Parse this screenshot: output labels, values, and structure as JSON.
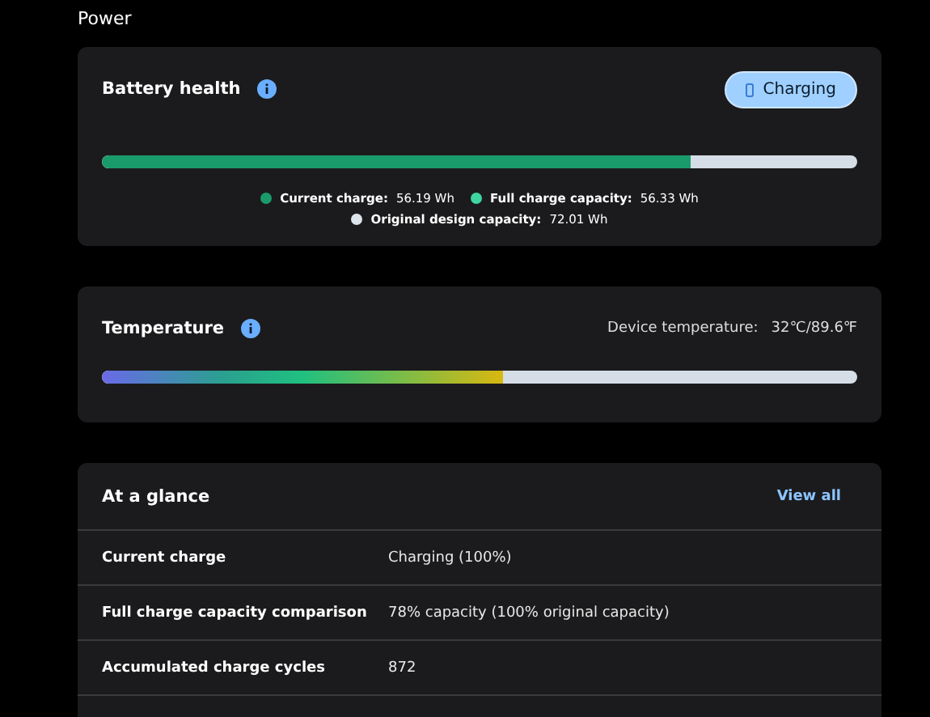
{
  "page_title": "Power",
  "battery": {
    "title": "Battery health",
    "status_button": "Charging",
    "level": 0.78,
    "legend": [
      {
        "label": "Current charge:",
        "value": "56.19 Wh",
        "color": "#1a9b6c"
      },
      {
        "label": "Full charge capacity:",
        "value": "56.33 Wh",
        "color": "#3fd4a0"
      },
      {
        "label": "Original design capacity:",
        "value": "72.01 Wh",
        "color": "#dde3ea"
      }
    ]
  },
  "temperature": {
    "title": "Temperature",
    "label": "Device temperature:",
    "value": "32℃/89.6℉",
    "level": 0.53
  },
  "glance": {
    "title": "At a glance",
    "link": "View all",
    "rows": [
      {
        "label": "Current charge",
        "value": "Charging (100%)"
      },
      {
        "label": "Full charge capacity comparison",
        "value": "78% capacity (100% original capacity)"
      },
      {
        "label": "Accumulated charge cycles",
        "value": "872"
      }
    ]
  }
}
